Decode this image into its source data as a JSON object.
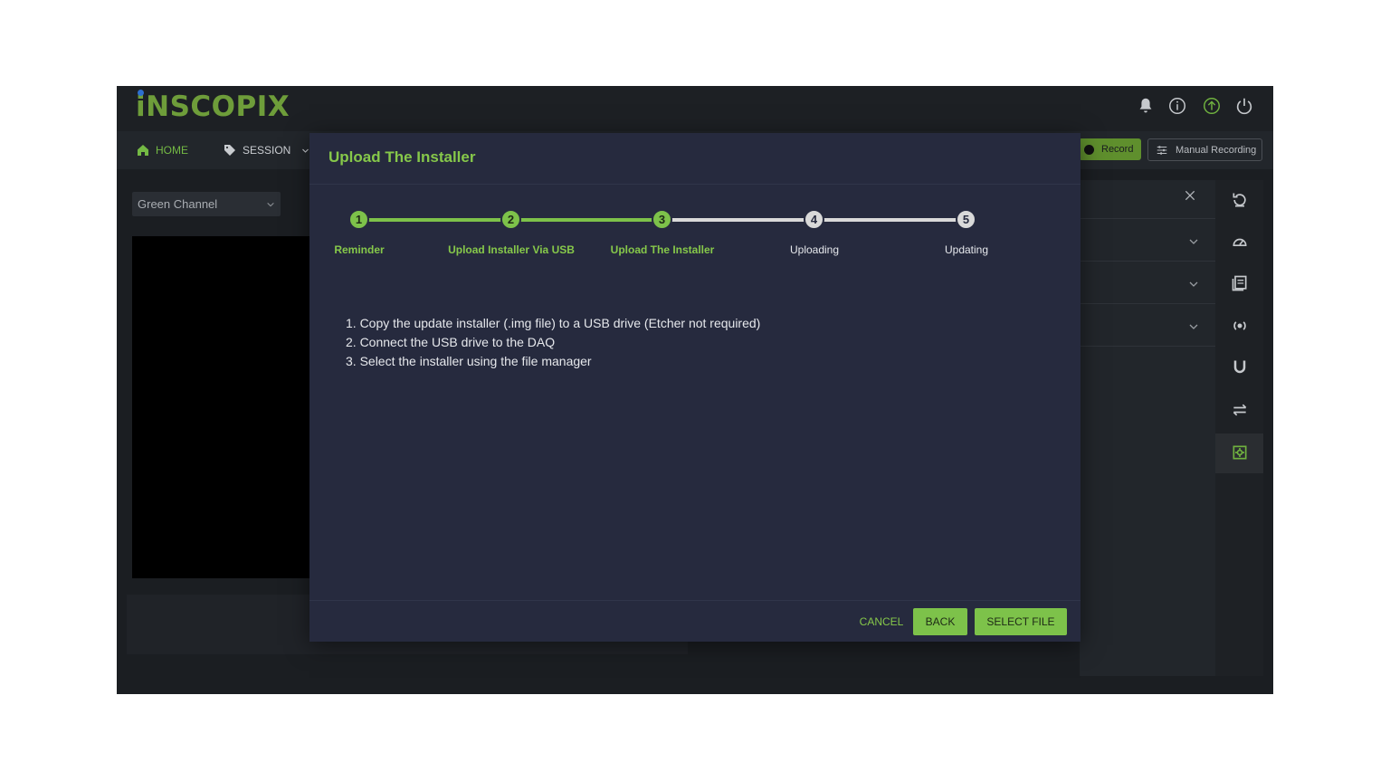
{
  "app": {
    "logo": "iNSCOPIX"
  },
  "nav": {
    "home_label": "HOME",
    "session_label": "SESSION",
    "record_label": "Record",
    "manual_recording_label": "Manual Recording"
  },
  "top_icons": [
    "bell-icon",
    "info-icon",
    "upload-icon",
    "power-icon"
  ],
  "left_panel": {
    "channel_value": "Green Channel"
  },
  "right_rail_icons": [
    "reset-icon",
    "gauge-icon",
    "book-icon",
    "broadcast-icon",
    "magnet-icon",
    "swap-icon",
    "settings-icon"
  ],
  "modal": {
    "title": "Upload The Installer",
    "steps": [
      {
        "number": "1",
        "label": "Reminder",
        "state": "complete"
      },
      {
        "number": "2",
        "label": "Upload Installer Via USB",
        "state": "complete"
      },
      {
        "number": "3",
        "label": "Upload The Installer",
        "state": "active"
      },
      {
        "number": "4",
        "label": "Uploading",
        "state": "pending"
      },
      {
        "number": "5",
        "label": "Updating",
        "state": "pending"
      }
    ],
    "instructions": [
      "1. Copy the update installer (.img file) to a USB drive (Etcher not required)",
      "2. Connect the USB drive to the DAQ",
      "3. Select the installer using the file manager"
    ],
    "cancel_label": "CANCEL",
    "back_label": "BACK",
    "select_file_label": "SELECT FILE"
  },
  "colors": {
    "accent_green": "#7dc24a",
    "modal_bg": "#262a3e",
    "pending_gray": "#d9d9d9"
  }
}
